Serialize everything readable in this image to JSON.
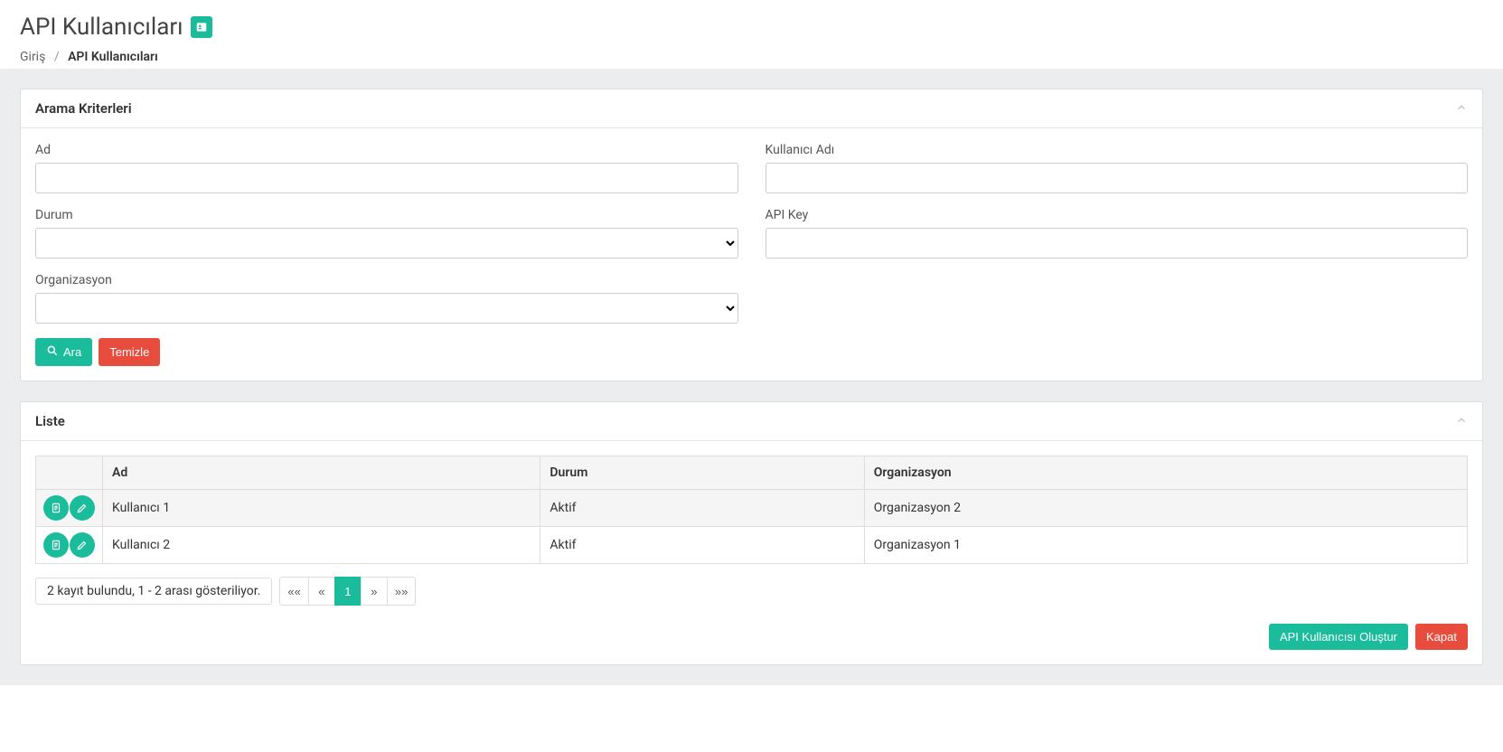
{
  "header": {
    "title": "API Kullanıcıları",
    "breadcrumb": {
      "home": "Giriş",
      "current": "API Kullanıcıları"
    }
  },
  "search_panel": {
    "title": "Arama Kriterleri",
    "fields": {
      "ad_label": "Ad",
      "kullanici_adi_label": "Kullanıcı Adı",
      "durum_label": "Durum",
      "api_key_label": "API Key",
      "organizasyon_label": "Organizasyon"
    },
    "buttons": {
      "search": "Ara",
      "clear": "Temizle"
    }
  },
  "list_panel": {
    "title": "Liste",
    "columns": {
      "ad": "Ad",
      "durum": "Durum",
      "organizasyon": "Organizasyon"
    },
    "rows": [
      {
        "ad": "Kullanıcı 1",
        "durum": "Aktif",
        "organizasyon": "Organizasyon 2"
      },
      {
        "ad": "Kullanıcı 2",
        "durum": "Aktif",
        "organizasyon": "Organizasyon 1"
      }
    ],
    "pager": {
      "info": "2 kayıt bulundu, 1 - 2 arası gösteriliyor.",
      "first": "««",
      "prev": "«",
      "page1": "1",
      "next": "»",
      "last": "»»"
    }
  },
  "footer": {
    "create": "API Kullanıcısı Oluştur",
    "close": "Kapat"
  }
}
